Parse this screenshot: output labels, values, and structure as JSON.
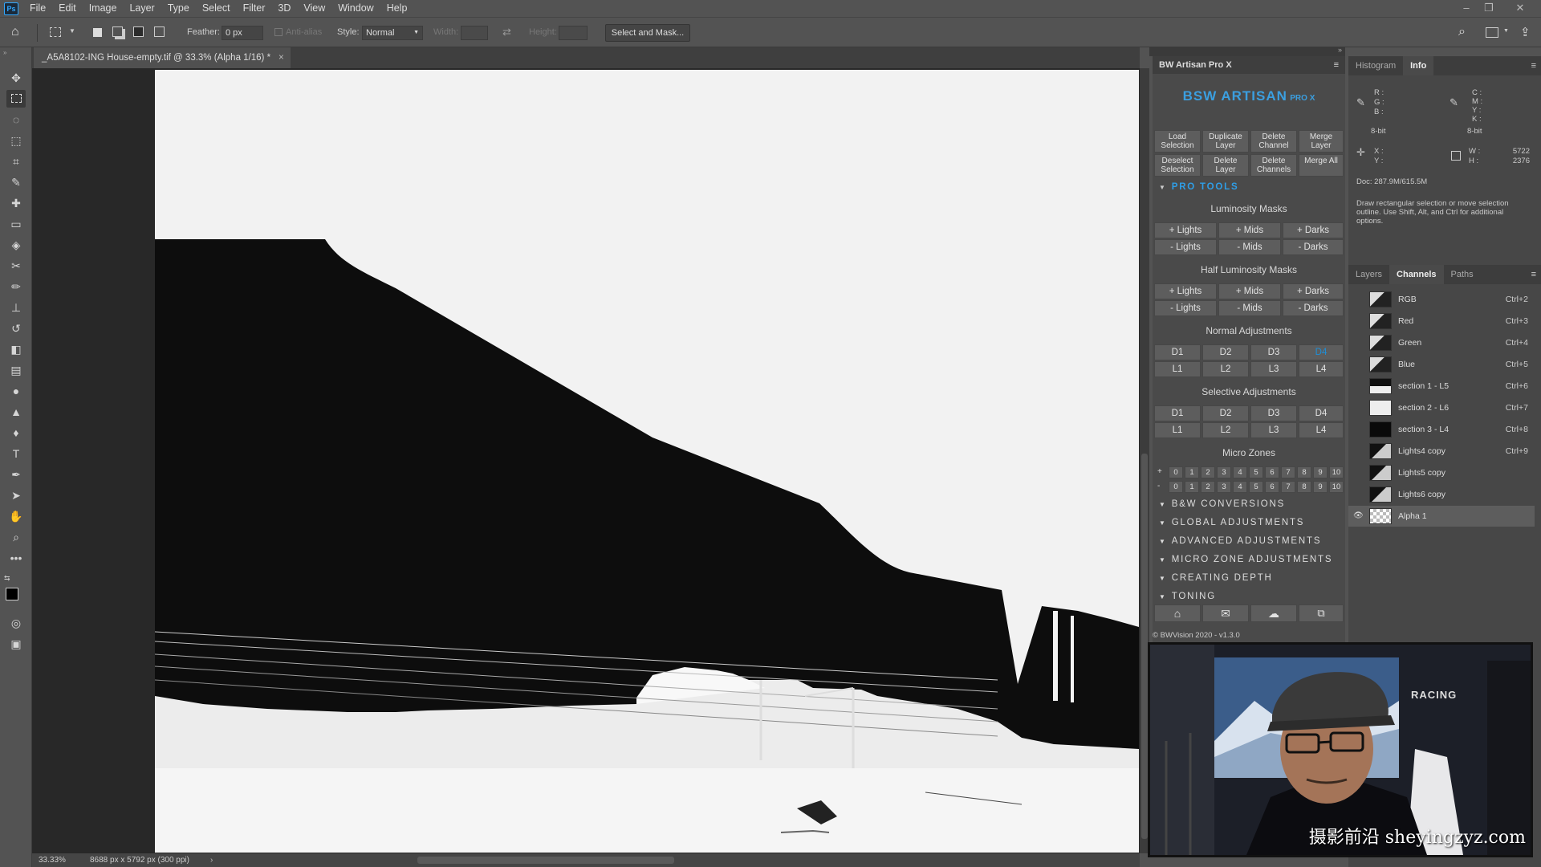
{
  "app": {
    "logo": "Ps"
  },
  "menu": [
    "File",
    "Edit",
    "Image",
    "Layer",
    "Type",
    "Select",
    "Filter",
    "3D",
    "View",
    "Window",
    "Help"
  ],
  "options": {
    "feather_label": "Feather:",
    "feather_value": "0 px",
    "antialias_label": "Anti-alias",
    "style_label": "Style:",
    "style_value": "Normal",
    "width_label": "Width:",
    "height_label": "Height:",
    "select_mask": "Select and Mask..."
  },
  "document": {
    "tab_title": "_A5A8102-ING House-empty.tif @ 33.3% (Alpha 1/16) *",
    "zoom": "33.33%",
    "dimensions": "8688 px x 5792 px (300 ppi)"
  },
  "bw_panel": {
    "title": "BW Artisan Pro X",
    "logo_text": "BSW ARTISAN",
    "logo_sub": "PRO X",
    "top_buttons": [
      "Load Selection",
      "Duplicate Layer",
      "Delete Channel",
      "Merge Layer",
      "Deselect Selection",
      "Delete Layer",
      "Delete Channels",
      "Merge All"
    ],
    "pro_tools": "PRO TOOLS",
    "lum_title": "Luminosity Masks",
    "lum_buttons": [
      "+ Lights",
      "+ Mids",
      "+ Darks",
      "- Lights",
      "- Mids",
      "- Darks"
    ],
    "half_title": "Half Luminosity Masks",
    "half_buttons": [
      "+ Lights",
      "+ Mids",
      "+ Darks",
      "- Lights",
      "- Mids",
      "- Darks"
    ],
    "normal_title": "Normal Adjustments",
    "normal_buttons": [
      "D1",
      "D2",
      "D3",
      "D4",
      "L1",
      "L2",
      "L3",
      "L4"
    ],
    "selective_title": "Selective Adjustments",
    "selective_buttons": [
      "D1",
      "D2",
      "D3",
      "D4",
      "L1",
      "L2",
      "L3",
      "L4"
    ],
    "micro_title": "Micro Zones",
    "micro_plus": "+",
    "micro_minus": "-",
    "micro_numbers": [
      "0",
      "1",
      "2",
      "3",
      "4",
      "5",
      "6",
      "7",
      "8",
      "9",
      "10"
    ],
    "sections": [
      "B&W CONVERSIONS",
      "GLOBAL ADJUSTMENTS",
      "ADVANCED ADJUSTMENTS",
      "MICRO ZONE ADJUSTMENTS",
      "CREATING DEPTH",
      "TONING"
    ],
    "footer": "© BWVision 2020 - v1.3.0",
    "accent": "#1e8fd8"
  },
  "info_panel": {
    "tabs": [
      "Histogram",
      "Info"
    ],
    "rgb_labels": [
      "R :",
      "G :",
      "B :"
    ],
    "cmyk_labels": [
      "C :",
      "M :",
      "Y :",
      "K :"
    ],
    "bit_left": "8-bit",
    "bit_right": "8-bit",
    "xy_labels": [
      "X :",
      "Y :"
    ],
    "w_label": "W :",
    "h_label": "H :",
    "w_value": "5722",
    "h_value": "2376",
    "doc": "Doc: 287.9M/615.5M",
    "hint": "Draw rectangular selection or move selection outline.  Use Shift, Alt, and Ctrl for additional options."
  },
  "layers_panel": {
    "tabs": [
      "Layers",
      "Channels",
      "Paths"
    ],
    "channels": [
      {
        "name": "RGB",
        "key": "Ctrl+2"
      },
      {
        "name": "Red",
        "key": "Ctrl+3"
      },
      {
        "name": "Green",
        "key": "Ctrl+4"
      },
      {
        "name": "Blue",
        "key": "Ctrl+5"
      },
      {
        "name": "section 1 - L5",
        "key": "Ctrl+6"
      },
      {
        "name": "section 2 - L6",
        "key": "Ctrl+7"
      },
      {
        "name": "section 3 - L4",
        "key": "Ctrl+8"
      },
      {
        "name": "Lights4 copy",
        "key": "Ctrl+9"
      },
      {
        "name": "Lights5 copy",
        "key": ""
      },
      {
        "name": "Lights6 copy",
        "key": ""
      },
      {
        "name": "Alpha 1",
        "key": ""
      }
    ]
  },
  "overlay": {
    "watermark": "摄影前沿 sheyingzyz.com",
    "cap_text": "RACING"
  }
}
